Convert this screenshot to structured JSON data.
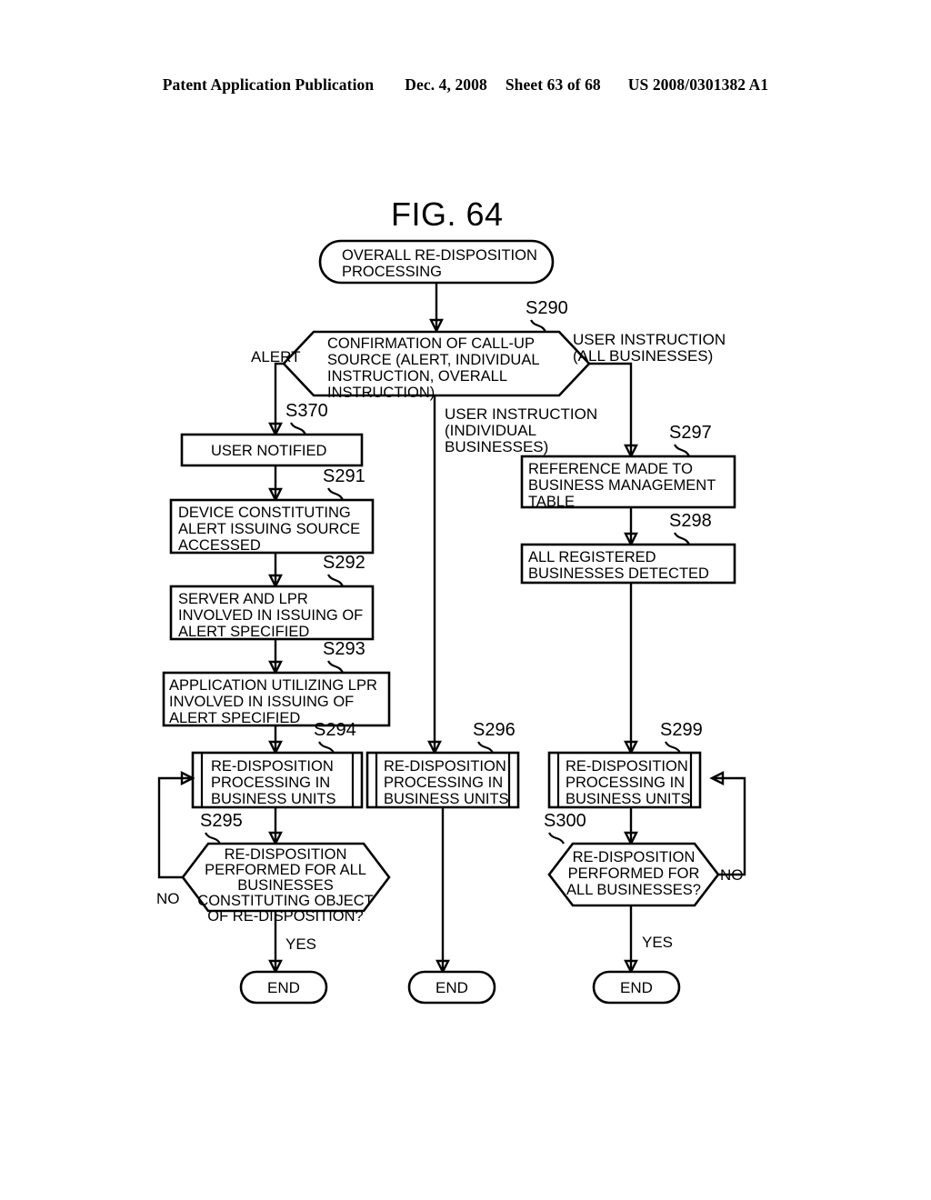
{
  "header": {
    "publication": "Patent Application Publication",
    "date": "Dec. 4, 2008",
    "sheet": "Sheet 63 of 68",
    "doc_number": "US 2008/0301382 A1"
  },
  "figure": {
    "title": "FIG. 64"
  },
  "nodes": {
    "start": {
      "text_line1": "OVERALL RE-DISPOSITION",
      "text_line2": "PROCESSING"
    },
    "s290": {
      "step": "S290",
      "line1": "CONFIRMATION OF CALL-UP",
      "line2": "SOURCE (ALERT, INDIVIDUAL",
      "line3": "INSTRUCTION, OVERALL",
      "line4": "INSTRUCTION)"
    },
    "s370": {
      "step": "S370",
      "line1": "USER NOTIFIED"
    },
    "s291": {
      "step": "S291",
      "line1": "DEVICE CONSTITUTING",
      "line2": "ALERT ISSUING SOURCE",
      "line3": "ACCESSED"
    },
    "s292": {
      "step": "S292",
      "line1": "SERVER AND LPR",
      "line2": "INVOLVED IN ISSUING OF",
      "line3": "ALERT SPECIFIED"
    },
    "s293": {
      "step": "S293",
      "line1": "APPLICATION UTILIZING LPR",
      "line2": "INVOLVED IN ISSUING OF",
      "line3": "ALERT SPECIFIED"
    },
    "s294": {
      "step": "S294",
      "line1": "RE-DISPOSITION",
      "line2": "PROCESSING IN",
      "line3": "BUSINESS UNITS"
    },
    "s295": {
      "step": "S295",
      "line1": "RE-DISPOSITION",
      "line2": "PERFORMED FOR ALL",
      "line3": "BUSINESSES",
      "line4": "CONSTITUTING OBJECT",
      "line5": "OF RE-DISPOSITION?"
    },
    "s296": {
      "step": "S296",
      "line1": "RE-DISPOSITION",
      "line2": "PROCESSING IN",
      "line3": "BUSINESS UNITS"
    },
    "s297": {
      "step": "S297",
      "line1": "REFERENCE MADE TO",
      "line2": "BUSINESS MANAGEMENT",
      "line3": "TABLE"
    },
    "s298": {
      "step": "S298",
      "line1": "ALL REGISTERED",
      "line2": "BUSINESSES DETECTED"
    },
    "s299": {
      "step": "S299",
      "line1": "RE-DISPOSITION",
      "line2": "PROCESSING IN",
      "line3": "BUSINESS UNITS"
    },
    "s300": {
      "step": "S300",
      "line1": "RE-DISPOSITION",
      "line2": "PERFORMED FOR",
      "line3": "ALL BUSINESSES?"
    },
    "end_left": {
      "text": "END"
    },
    "end_mid": {
      "text": "END"
    },
    "end_right": {
      "text": "END"
    }
  },
  "branch_labels": {
    "alert": "ALERT",
    "user_instruction_all_l1": "USER INSTRUCTION",
    "user_instruction_all_l2": "(ALL BUSINESSES)",
    "user_instruction_ind_l1": "USER INSTRUCTION",
    "user_instruction_ind_l2": "(INDIVIDUAL",
    "user_instruction_ind_l3": "BUSINESSES)",
    "no_left": "NO",
    "yes_left": "YES",
    "no_right": "NO",
    "yes_right": "YES"
  },
  "colors": {
    "ink": "#000000",
    "paper": "#ffffff"
  }
}
